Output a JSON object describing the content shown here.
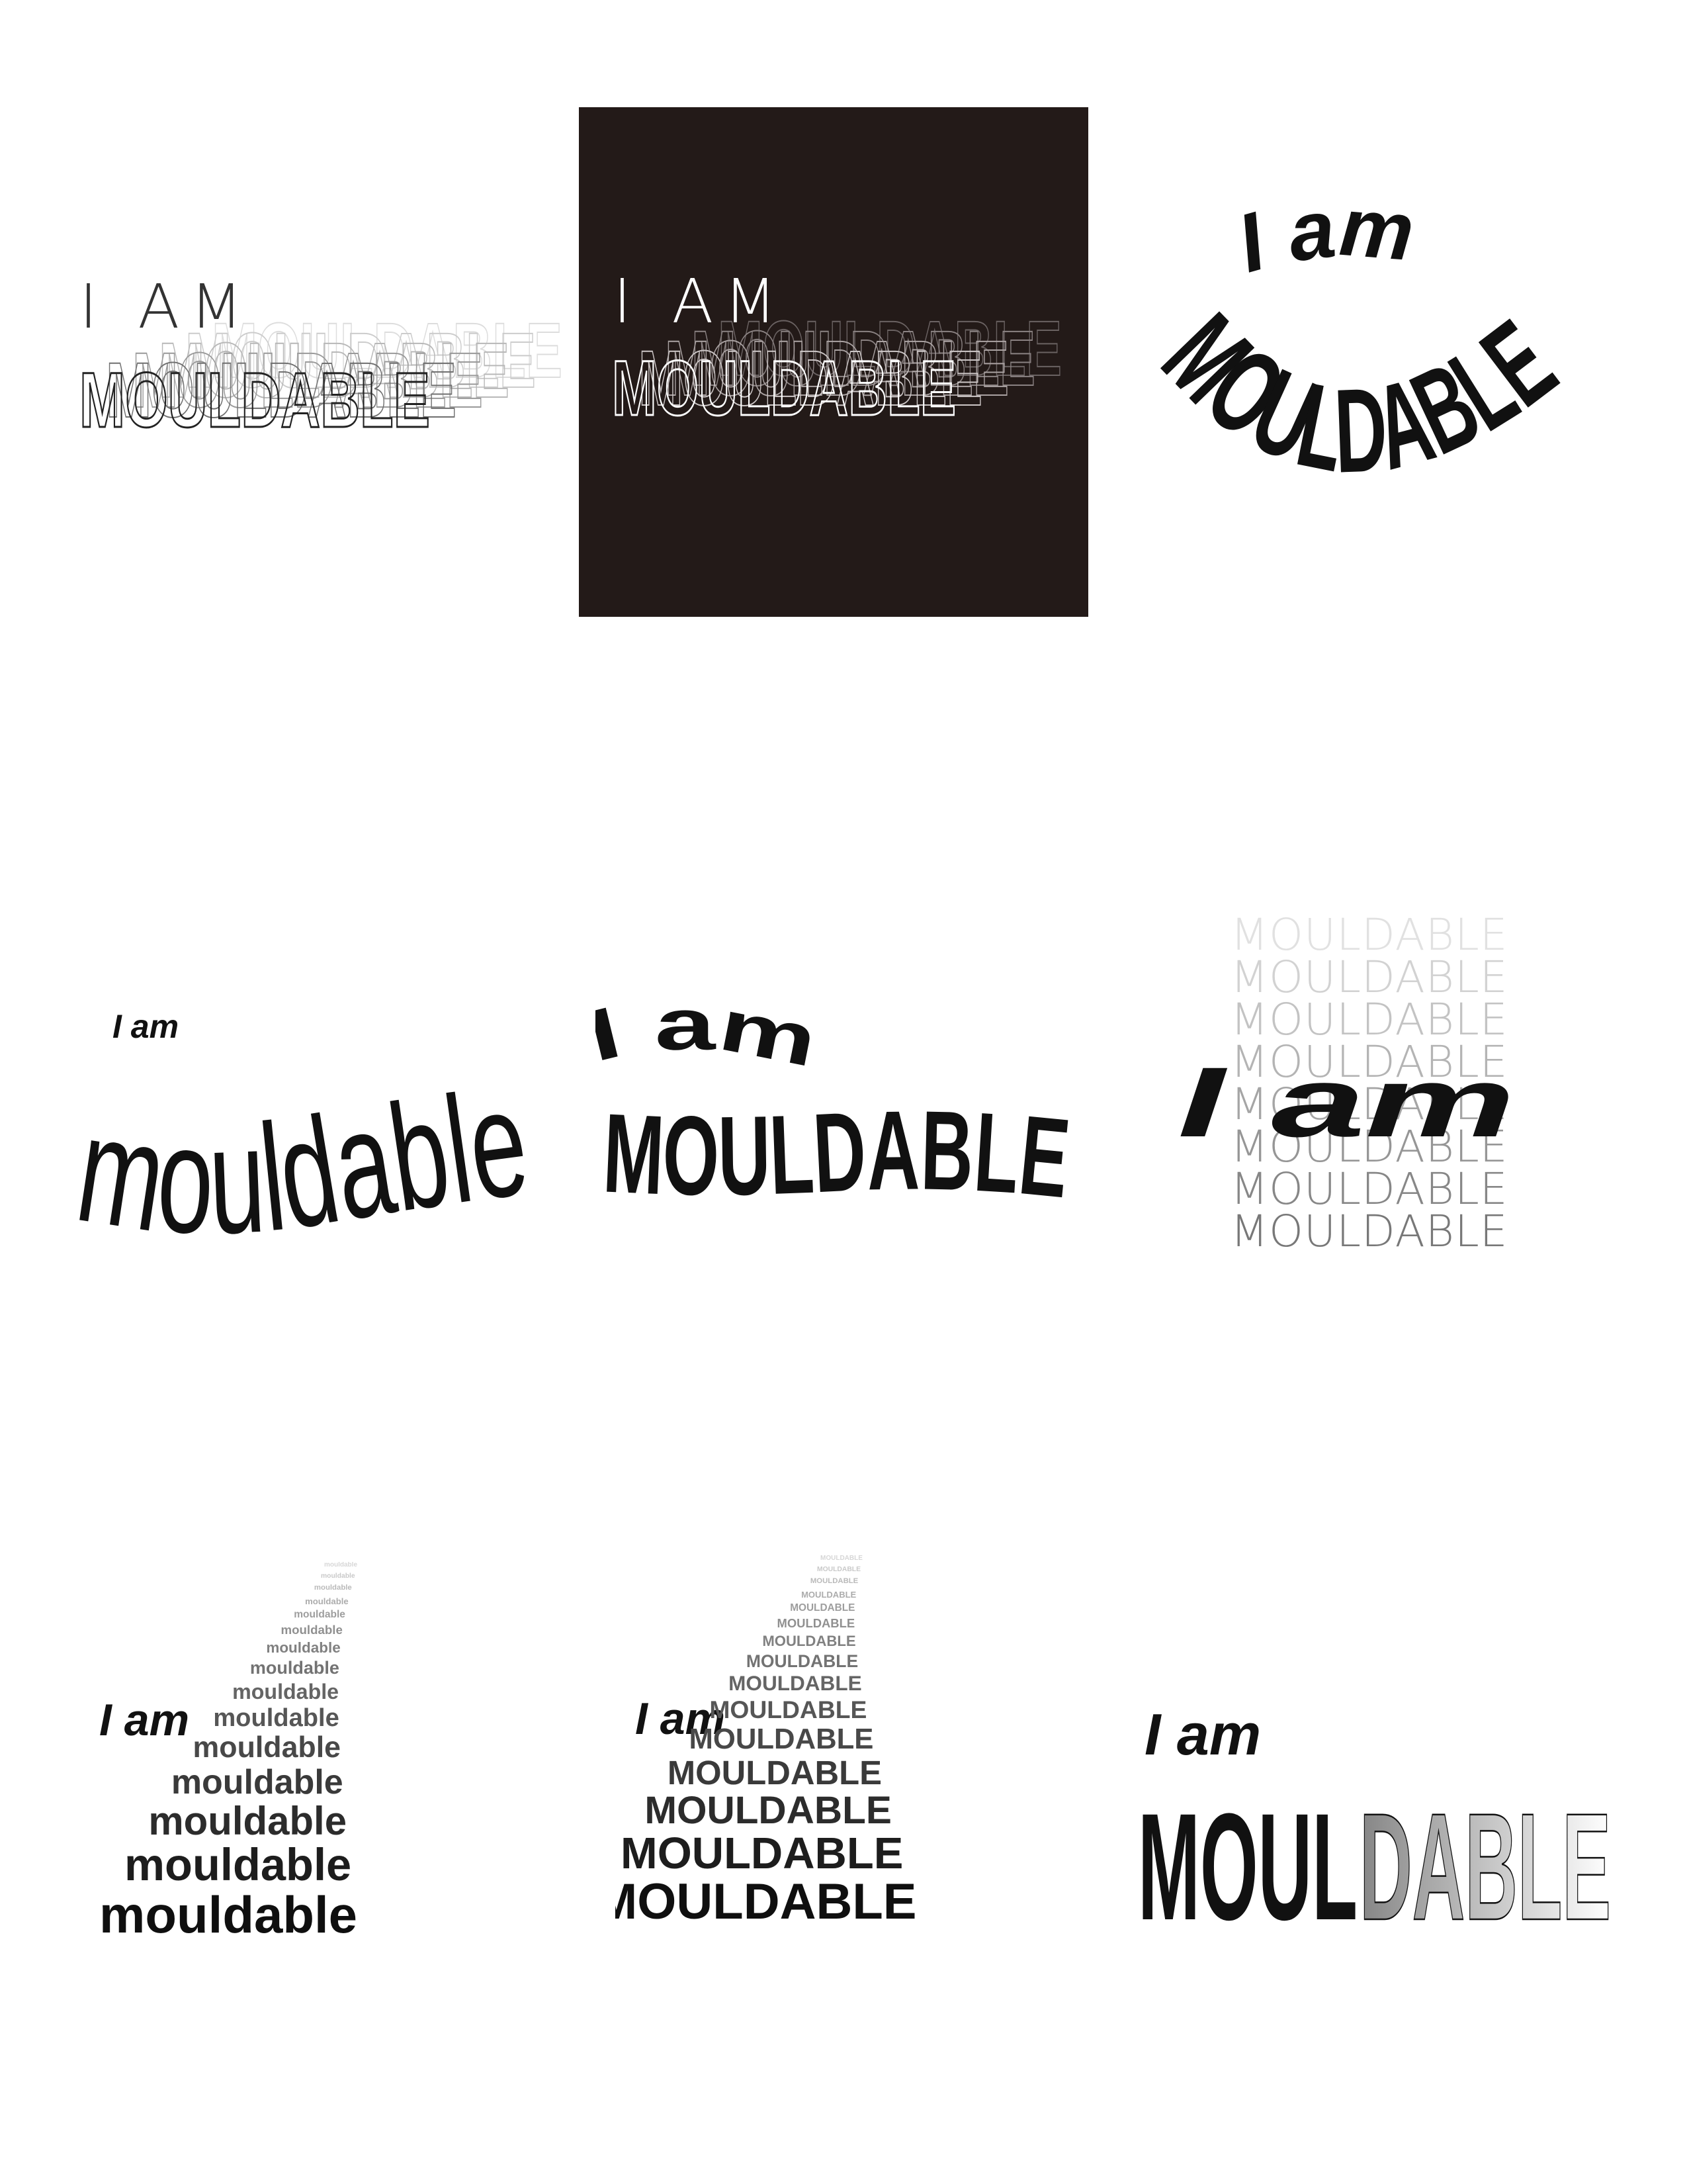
{
  "designs": [
    {
      "id": "echo-outline-white",
      "intro": "I AM",
      "word": "MOULDABLE"
    },
    {
      "id": "echo-outline-black",
      "intro": "I AM",
      "word": "MOULDABLE",
      "background": "#231a18"
    },
    {
      "id": "arc-bulge",
      "intro": "I am",
      "word": "MOULDABLE"
    },
    {
      "id": "condensed-wave",
      "intro": "I am",
      "word": "mouldable"
    },
    {
      "id": "wave-heavy",
      "intro": "I am",
      "word": "MOULDABLE"
    },
    {
      "id": "repeat-overlay",
      "intro": "I am",
      "word": "MOULDABLE",
      "repeat_count": 8
    },
    {
      "id": "cascade-lower",
      "intro": "I am",
      "word": "mouldable",
      "repeat_count": 15
    },
    {
      "id": "cascade-upper",
      "intro": "I am",
      "word": "MOULDABLE",
      "repeat_count": 15
    },
    {
      "id": "gradient-fade",
      "intro": "I am",
      "word": "MOULDABLE",
      "word_split": [
        "MOUL",
        "DABLE"
      ]
    }
  ],
  "colors": {
    "ink": "#111111",
    "dark_panel": "#231a18",
    "paper": "#ffffff"
  }
}
